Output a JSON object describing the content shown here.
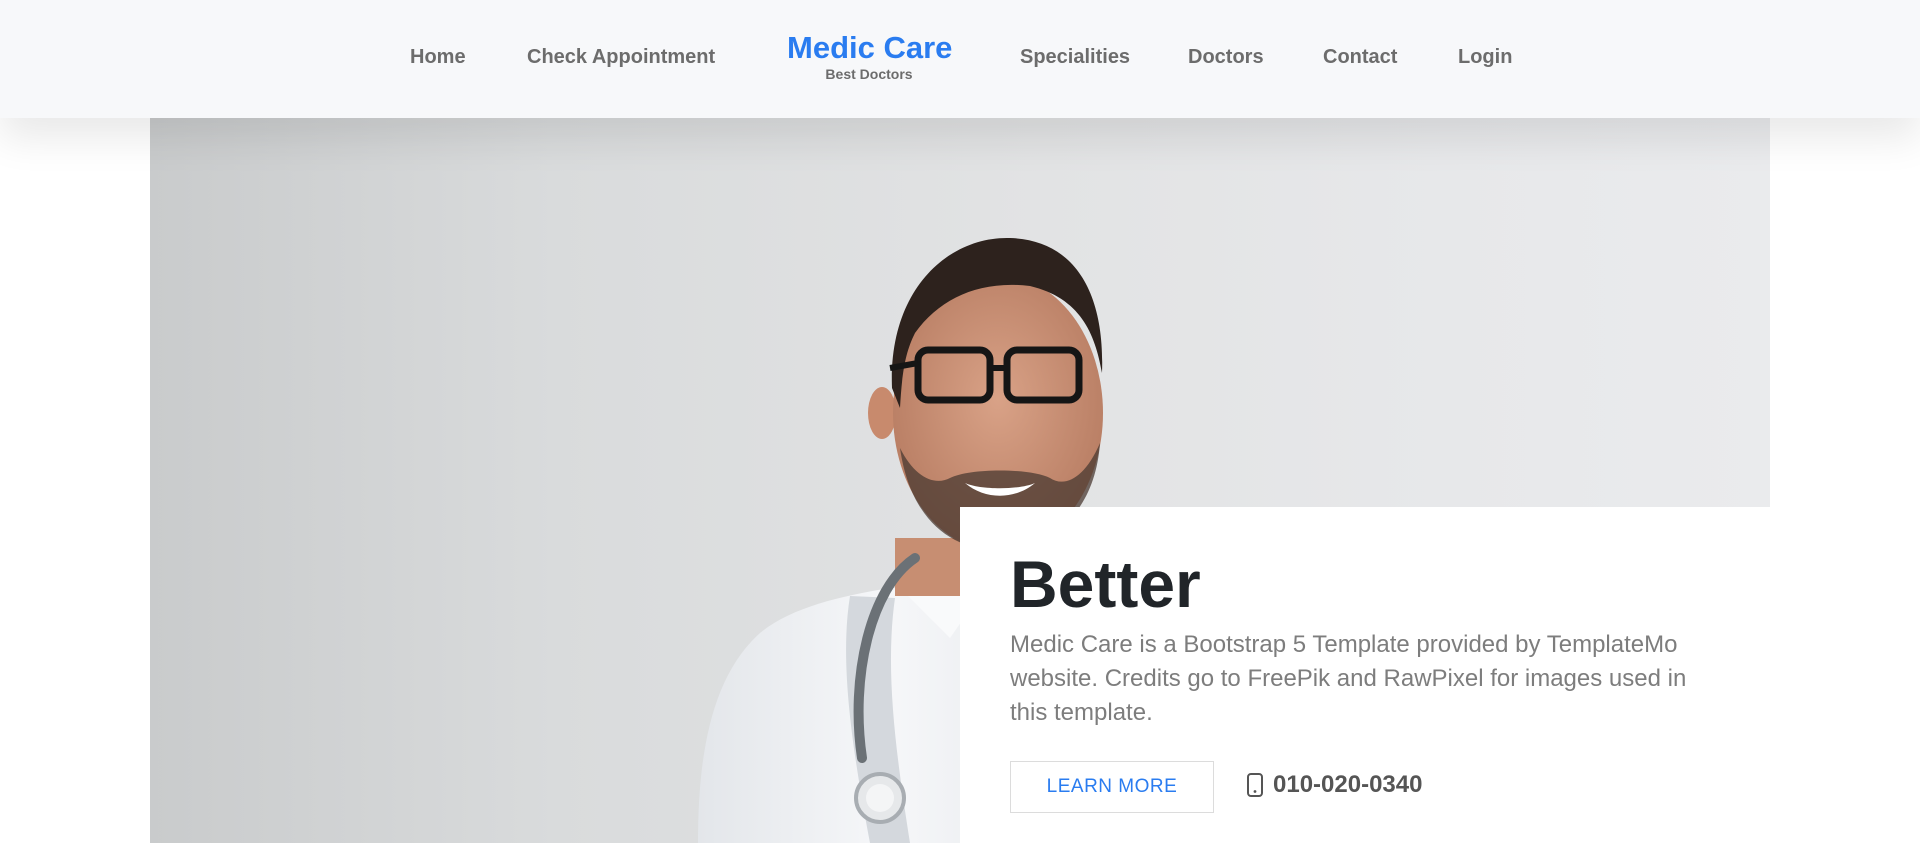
{
  "navbar": {
    "links_left": [
      "Home",
      "Check Appointment"
    ],
    "brand": {
      "title": "Medic Care",
      "subtitle": "Best Doctors"
    },
    "links_right": [
      "Specialities",
      "Doctors",
      "Contact",
      "Login"
    ]
  },
  "hero": {
    "heading": "Better",
    "description": "Medic Care is a Bootstrap 5 Template provided by TemplateMo website. Credits go to FreePik and RawPixel for images used in this template.",
    "button_label": "LEARN MORE",
    "phone": "010-020-0340",
    "phone_icon": "phone-icon"
  },
  "colors": {
    "brand": "#2a7cf0",
    "nav_text": "#6c6c6c",
    "heading": "#212529",
    "body_text": "#7d7d7d",
    "navbar_bg": "#f7f8fa"
  }
}
